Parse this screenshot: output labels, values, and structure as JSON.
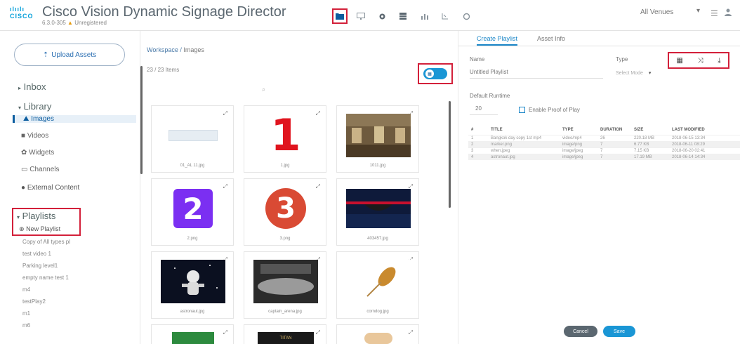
{
  "header": {
    "logo_bars": "ılıılı",
    "logo_text": "CISCO",
    "title": "Cisco Vision Dynamic Signage Director",
    "version": "6.3.0-305",
    "status": "Unregistered",
    "venue_selector": "All Venues"
  },
  "leftnav": {
    "upload_label": "Upload Assets",
    "inbox_label": "Inbox",
    "library_label": "Library",
    "library_items": [
      "Images",
      "Videos",
      "Widgets",
      "Channels"
    ],
    "external_content": "External Content",
    "playlists_label": "Playlists",
    "new_playlist": "New Playlist",
    "playlist_items": [
      "Copy of All types pl",
      "test video 1",
      "Parking level1",
      "empty name test 1",
      "m4",
      "testPlay2",
      "m1",
      "m6"
    ]
  },
  "middle": {
    "breadcrumb_root": "Workspace /",
    "breadcrumb_current": "Images",
    "item_count": "23 / 23 Items",
    "tiles": [
      {
        "name": "01_AL 11.jpg"
      },
      {
        "name": "1.jpg",
        "numeral": "1"
      },
      {
        "name": "1011.jpg"
      },
      {
        "name": "2.png",
        "numeral": "2"
      },
      {
        "name": "3.png",
        "numeral": "3"
      },
      {
        "name": "403457.jpg"
      },
      {
        "name": "astronaut.jpg"
      },
      {
        "name": "captain_arena.jpg"
      },
      {
        "name": "corndog.jpg"
      },
      {
        "name": ""
      },
      {
        "name": "",
        "caption": "TITAN"
      },
      {
        "name": ""
      }
    ]
  },
  "rightpanel": {
    "tabs": [
      "Create Playlist",
      "Asset Info"
    ],
    "name_label": "Name",
    "name_placeholder": "Untitled Playlist",
    "type_label": "Type",
    "type_placeholder": "Select Mode",
    "duration_label": "Default Runtime",
    "duration_value": "20",
    "proof_label": "Enable Proof of Play",
    "columns": [
      "#",
      "TITLE",
      "TYPE",
      "DURATION",
      "SIZE",
      "LAST MODIFIED"
    ],
    "rows": [
      {
        "n": "1",
        "title": "Bangkok day copy 1st mp4",
        "type": "video/mp4",
        "duration": "26",
        "size": "220.18 MB",
        "modified": "2018-06-15 13:34"
      },
      {
        "n": "2",
        "title": "marker.png",
        "type": "image/png",
        "duration": "7",
        "size": "6.77 KB",
        "modified": "2018-06-11 08:29"
      },
      {
        "n": "3",
        "title": "when.jpeg",
        "type": "image/jpeg",
        "duration": "7",
        "size": "7.15 KB",
        "modified": "2018-06-20 02:41"
      },
      {
        "n": "4",
        "title": "astronaut.jpg",
        "type": "image/jpeg",
        "duration": "7",
        "size": "17.19 MB",
        "modified": "2018-06-14 14:34"
      }
    ],
    "cancel_label": "Cancel",
    "save_label": "Save"
  },
  "colors": {
    "accent": "#1a96d5",
    "highlight": "#d3203a",
    "nav_blue": "#0c5d9f"
  },
  "icons": [
    "folder-icon",
    "display-icon",
    "gear-icon",
    "grid-icon",
    "chart-icon",
    "sensor-icon",
    "settings-icon",
    "shuffle-icon",
    "download-icon",
    "menu-icon",
    "user-icon"
  ]
}
